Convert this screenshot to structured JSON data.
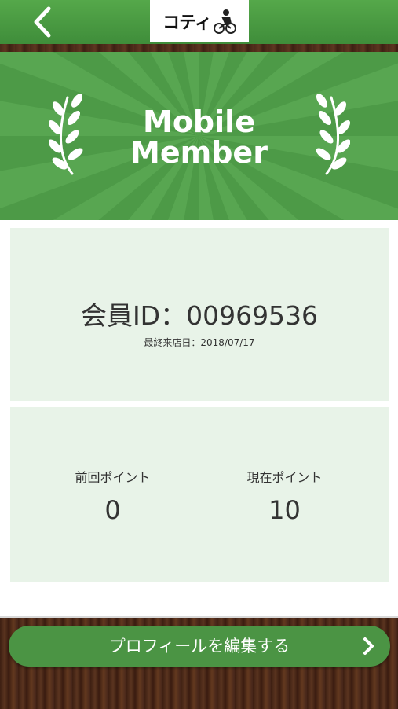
{
  "header": {
    "back_icon": "chevron-left-icon",
    "logo_text": "コティ",
    "logo_icon": "cyclist-icon"
  },
  "hero": {
    "title_line1": "Mobile",
    "title_line2": "Member",
    "decoration_icon": "laurel-icon",
    "background_color": "#4d9a47"
  },
  "member": {
    "id_text": "会員ID：00969536",
    "last_visit": "最終来店日：2018/07/17"
  },
  "points": {
    "previous_label": "前回ポイント",
    "previous_value": "0",
    "current_label": "現在ポイント",
    "current_value": "10"
  },
  "footer": {
    "edit_profile_label": "プロフィールを編集する",
    "chevron_icon": "chevron-right-icon",
    "button_color": "#4b9444"
  }
}
